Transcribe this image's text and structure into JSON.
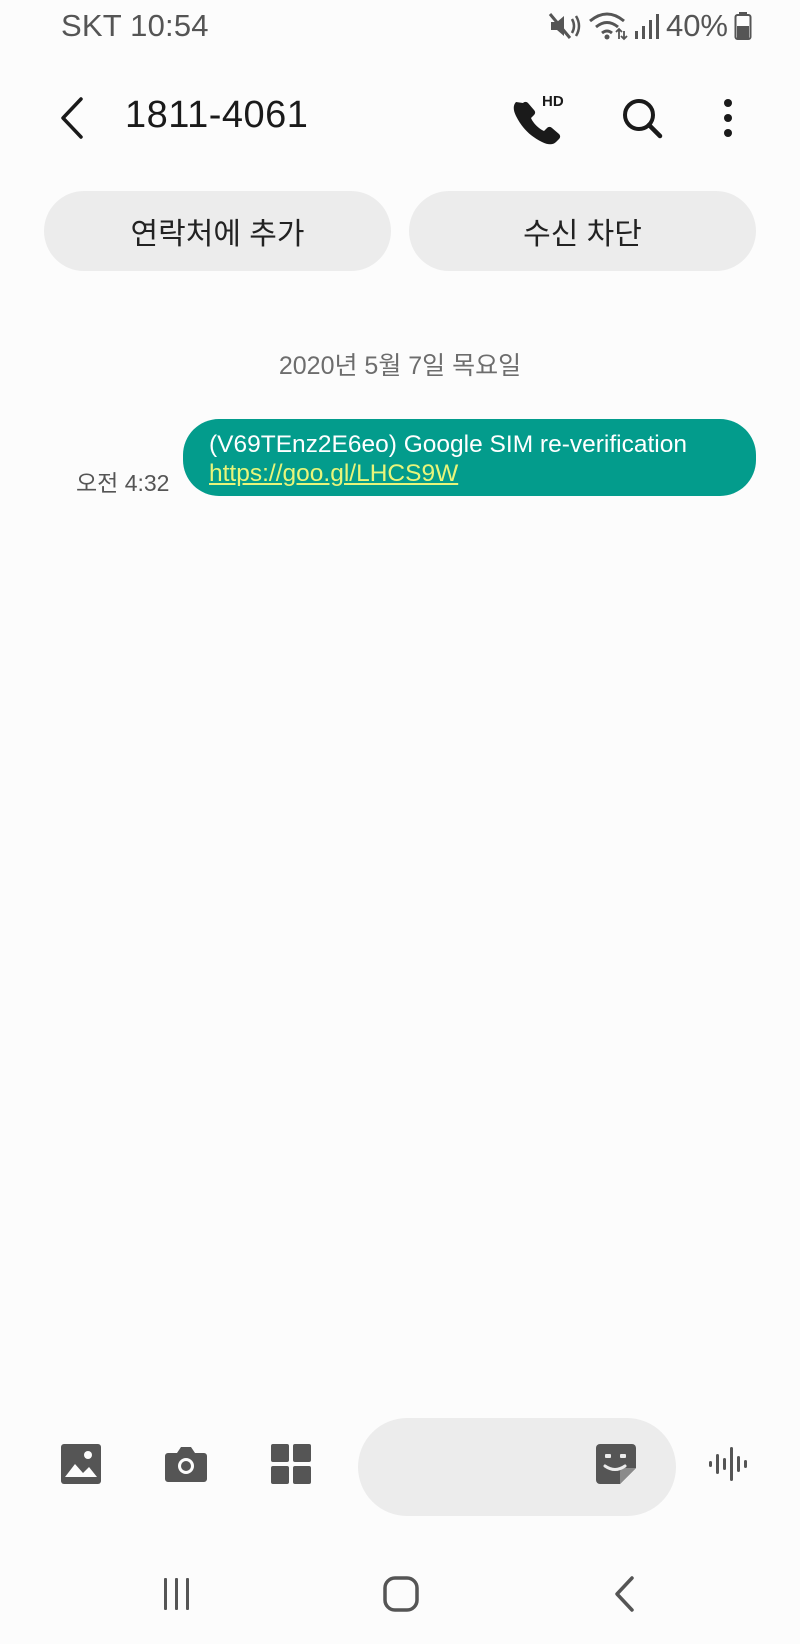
{
  "status_bar": {
    "carrier_time": "SKT 10:54",
    "battery": "40%",
    "icons": [
      "mute-vibrate-icon",
      "wifi-icon",
      "signal-icon",
      "battery-icon"
    ]
  },
  "header": {
    "title": "1811-4061",
    "hd_badge": "HD",
    "icons": [
      "back-icon",
      "hd-call-icon",
      "search-icon",
      "more-icon"
    ]
  },
  "actions": {
    "add_contact": "연락처에 추가",
    "block": "수신 차단"
  },
  "conversation": {
    "date": "2020년 5월 7일 목요일",
    "messages": [
      {
        "time": "오전 4:32",
        "text": "(V69TEnz2E6eo) Google SIM re-verification",
        "link": "https://goo.gl/LHCS9W"
      }
    ]
  },
  "composer": {
    "placeholder": "",
    "icons": [
      "gallery-icon",
      "camera-icon",
      "apps-icon",
      "sticker-icon",
      "voice-icon"
    ]
  },
  "nav_bar": {
    "icons": [
      "recents-icon",
      "home-icon",
      "back-nav-icon"
    ]
  },
  "colors": {
    "bubble": "#039c8c",
    "link": "#e8f57a",
    "pill": "#ececec",
    "background": "#fcfcfc"
  }
}
